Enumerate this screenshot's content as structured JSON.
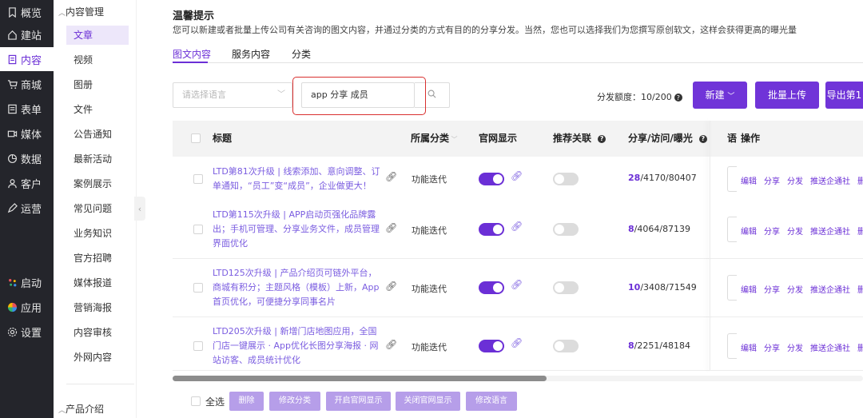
{
  "nav": {
    "items": [
      {
        "label": "概览",
        "icon": "bookmark-icon"
      },
      {
        "label": "建站",
        "icon": "home-icon"
      },
      {
        "label": "内容",
        "icon": "document-icon"
      },
      {
        "label": "商城",
        "icon": "cart-icon"
      },
      {
        "label": "表单",
        "icon": "form-icon"
      },
      {
        "label": "媒体",
        "icon": "video-icon"
      },
      {
        "label": "数据",
        "icon": "chart-icon"
      },
      {
        "label": "客户",
        "icon": "user-icon"
      },
      {
        "label": "运营",
        "icon": "pen-icon"
      },
      {
        "label": "启动",
        "icon": "launch-dots-icon"
      },
      {
        "label": "应用",
        "icon": "apps-color-icon"
      },
      {
        "label": "设置",
        "icon": "gear-icon"
      }
    ],
    "active": "内容"
  },
  "sidebar": {
    "group_title": "内容管理",
    "items": [
      "文章",
      "视频",
      "图册",
      "文件",
      "公告通知",
      "最新活动",
      "案例展示",
      "常见问题",
      "业务知识",
      "官方招聘",
      "媒体报道",
      "营销海报",
      "内容审核",
      "外网内容"
    ],
    "active": "文章",
    "group_title_2": "产品介绍",
    "collapse_glyph": "‹"
  },
  "tip": {
    "title": "温馨提示",
    "text": "您可以新建或者批量上传公司有关咨询的图文内容，并通过分类的方式有目的的分享分发。当然，您也可以选择我们为您撰写原创软文，这样会获得更高的曝光量"
  },
  "tabs": [
    "图文内容",
    "服务内容",
    "分类"
  ],
  "filters": {
    "language_placeholder": "请选择语言",
    "search_value": "app 分享 成员"
  },
  "quota": {
    "label": "分发额度：10/200"
  },
  "buttons": {
    "new": "新建",
    "batch_upload": "批量上传",
    "export": "导出第1"
  },
  "table": {
    "headers": {
      "title": "标题",
      "category": "所属分类",
      "site_display": "官网显示",
      "recommend": "推荐关联",
      "stats": "分享/访问/曝光",
      "lang": "语",
      "ops": "操作"
    },
    "rows": [
      {
        "title": "LTD第81次升级 | 线索添加、意向调整、订单通知，“员工”变“成员”，企业做更大！",
        "category": "功能迭代",
        "site_display": true,
        "recommend": false,
        "shares": "28",
        "rest": "/4170/80407"
      },
      {
        "title": "LTD第115次升级 | APP启动页强化品牌露出；手机可管理、分享业务文件，成员管理界面优化",
        "category": "功能迭代",
        "site_display": true,
        "recommend": false,
        "shares": "8",
        "rest": "/4064/87139"
      },
      {
        "title": "LTD125次升级 | 产品介绍页可链外平台，商城有积分；主题风格（模板）上新，App首页优化，可便捷分享同事名片",
        "category": "功能迭代",
        "site_display": true,
        "recommend": false,
        "shares": "10",
        "rest": "/3408/71549"
      },
      {
        "title": "LTD205次升级 | 新增门店地图应用，全国门店一键展示 · App优化长图分享海报 · 网站访客、成员统计优化",
        "category": "功能迭代",
        "site_display": true,
        "recommend": false,
        "shares": "8",
        "rest": "/2251/48184"
      }
    ],
    "ops": [
      "编辑",
      "分享",
      "分发",
      "推送企通社",
      "删除"
    ]
  },
  "footer": {
    "select_all": "全选",
    "buttons": [
      "删除",
      "修改分类",
      "开启官网显示",
      "关闭官网显示",
      "修改语言"
    ]
  },
  "colors": {
    "accent": "#6b2fd6",
    "nav_bg": "#24252b",
    "highlight": "#d9302f"
  }
}
